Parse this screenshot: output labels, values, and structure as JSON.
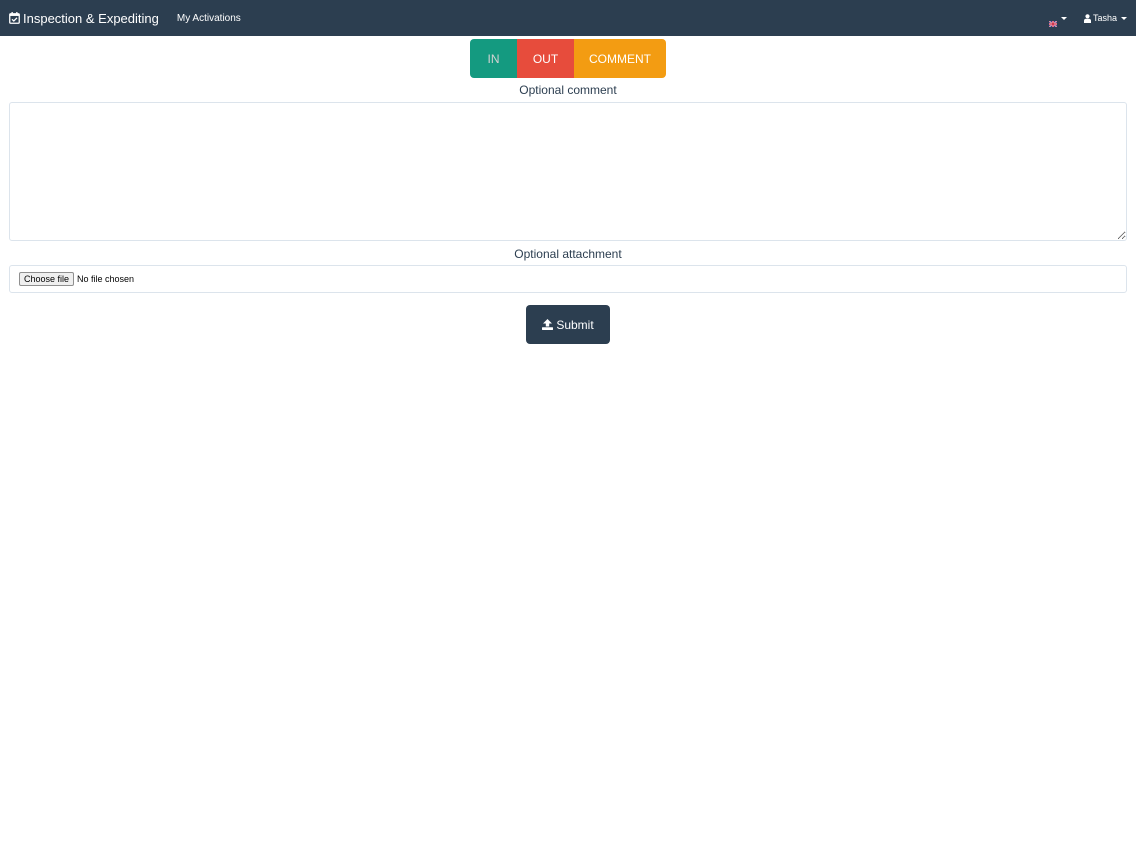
{
  "navbar": {
    "brand": "Inspection & Expediting",
    "brand_icon": "calendar-check-icon",
    "links": [
      {
        "label": "My Activations"
      }
    ],
    "language_icon": "uk-flag-icon",
    "user": {
      "name": "Tasha",
      "icon": "user-icon"
    }
  },
  "mode_buttons": {
    "in": "IN",
    "out": "OUT",
    "comment": "COMMENT",
    "selected": "IN"
  },
  "form": {
    "comment_label": "Optional comment",
    "comment_value": "",
    "attachment_label": "Optional attachment",
    "choose_file_label": "Choose file",
    "file_status": "No file chosen",
    "submit_label": "Submit",
    "submit_icon": "upload-icon"
  },
  "colors": {
    "navbar": "#2c3e50",
    "in": "#18bc9c",
    "out": "#e74c3c",
    "comment": "#f39c12",
    "submit": "#2c3e50"
  }
}
